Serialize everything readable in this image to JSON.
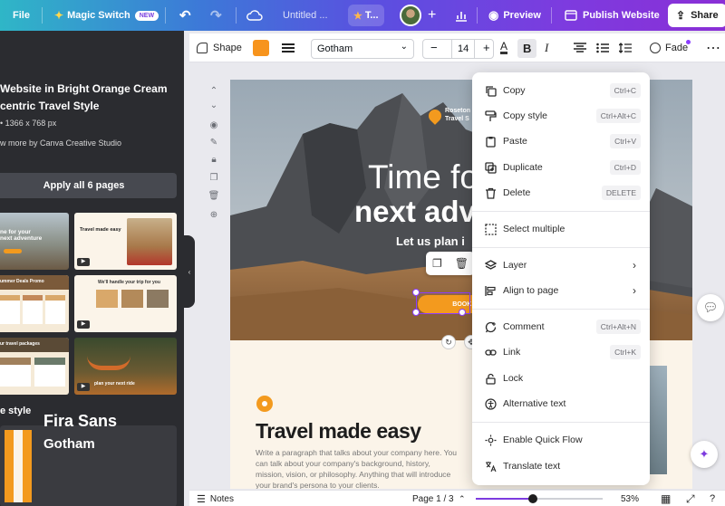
{
  "topbar": {
    "file_label": "File",
    "magic_switch_label": "Magic Switch",
    "new_badge": "NEW",
    "title": "Untitled ...",
    "text_tab": "T...",
    "preview_label": "Preview",
    "publish_label": "Publish Website",
    "share_label": "Share"
  },
  "left_panel": {
    "template_title": "Website in Bright Orange Cream Eccentric Travel Style",
    "template_title_visible": "Website in Bright Orange Cream\ncentric Travel Style",
    "template_size": "1366 x 768 px",
    "more_by": "w more by Canva Creative Studio",
    "apply_label": "Apply all 6 pages",
    "style_heading": "e style",
    "style_font_primary": "Fira Sans",
    "style_font_secondary": "Gotham",
    "thumbs": [
      {
        "caption": "ne for your\nnext adventure"
      },
      {
        "caption": "Travel made easy"
      },
      {
        "caption": "ummer Deals Promo"
      },
      {
        "caption": "We'll handle your trip for you"
      },
      {
        "caption": "ur travel packages"
      },
      {
        "caption": "plan your next ride"
      }
    ]
  },
  "toolbar": {
    "shape_label": "Shape",
    "color_swatch": "#f7941d",
    "font_name": "Gotham",
    "font_size": "14",
    "minus": "−",
    "plus": "+",
    "bold": "B",
    "italic": "I",
    "fade_label": "Fade"
  },
  "canvas": {
    "logo_text": "Roseton\nTravel S",
    "hero_line1": "Time fo",
    "hero_line2": "next adv",
    "hero_line3": "Let us plan i",
    "book_button": "BOOK NO",
    "section_title": "Travel made easy",
    "section_body": "Write a paragraph that talks about your company here. You can talk about your company's background, history, mission, vision, or philosophy. Anything that will introduce your brand's persona to your clients."
  },
  "context_menu": {
    "items": [
      {
        "label": "Copy",
        "shortcut": "Ctrl+C",
        "icon": "copy-icon"
      },
      {
        "label": "Copy style",
        "shortcut": "Ctrl+Alt+C",
        "icon": "paint-roller-icon"
      },
      {
        "label": "Paste",
        "shortcut": "Ctrl+V",
        "icon": "clipboard-icon"
      },
      {
        "label": "Duplicate",
        "shortcut": "Ctrl+D",
        "icon": "duplicate-icon"
      },
      {
        "label": "Delete",
        "shortcut": "DELETE",
        "icon": "trash-icon"
      },
      {
        "label": "Select multiple",
        "icon": "dashed-square-icon"
      },
      {
        "label": "Layer",
        "icon": "layers-icon"
      },
      {
        "label": "Align to page",
        "icon": "align-icon"
      },
      {
        "label": "Comment",
        "shortcut": "Ctrl+Alt+N",
        "icon": "comment-icon"
      },
      {
        "label": "Link",
        "shortcut": "Ctrl+K",
        "icon": "link-icon"
      },
      {
        "label": "Lock",
        "icon": "lock-icon"
      },
      {
        "label": "Alternative text",
        "icon": "accessibility-icon"
      },
      {
        "label": "Enable Quick Flow",
        "icon": "quick-flow-icon"
      },
      {
        "label": "Translate text",
        "icon": "translate-icon"
      }
    ]
  },
  "bottombar": {
    "notes_label": "Notes",
    "page_indicator": "Page 1 / 3",
    "zoom_level": "53%",
    "zoom_fraction": 0.45
  }
}
